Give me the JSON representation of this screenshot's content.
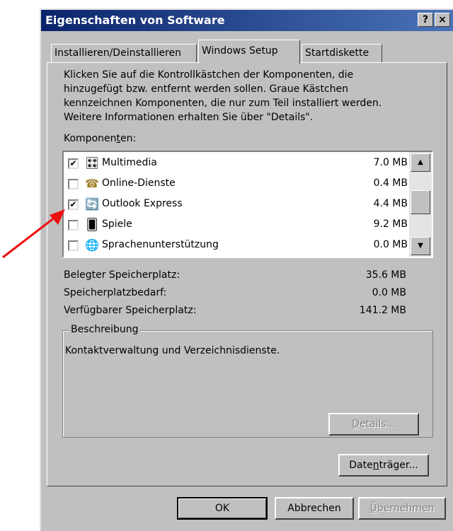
{
  "window": {
    "title": "Eigenschaften von Software",
    "help_button": "?",
    "close_button": "×"
  },
  "tabs": [
    {
      "label": "Installieren/Deinstallieren",
      "active": false
    },
    {
      "label": "Windows Setup",
      "active": true
    },
    {
      "label": "Startdiskette",
      "active": false
    }
  ],
  "instructions": [
    "Klicken Sie auf die Kontrollkästchen der Komponenten, die",
    "hinzugefügt bzw. entfernt werden sollen. Graue Kästchen",
    "kennzeichnen Komponenten, die nur zum Teil installiert werden.",
    "Weitere Informationen erhalten Sie über \"Details\"."
  ],
  "components_label_pre": "Komponen",
  "components_label_accel": "t",
  "components_label_post": "en:",
  "components": [
    {
      "name": "Multimedia",
      "size": "7.0 MB",
      "checked": true,
      "icon": "multimedia-icon",
      "glyph": "🎛"
    },
    {
      "name": "Online-Dienste",
      "size": "0.4 MB",
      "checked": false,
      "icon": "online-services-icon",
      "glyph": "☎"
    },
    {
      "name": "Outlook Express",
      "size": "4.4 MB",
      "checked": true,
      "icon": "outlook-express-icon",
      "glyph": "🔄"
    },
    {
      "name": "Spiele",
      "size": "9.2 MB",
      "checked": false,
      "icon": "games-icon",
      "glyph": "🂠"
    },
    {
      "name": "Sprachenunterstützung",
      "size": "0.0 MB",
      "checked": false,
      "icon": "globe-icon",
      "glyph": "🌐"
    }
  ],
  "space": {
    "used_label": "Belegter Speicherplatz:",
    "used_value": "35.6 MB",
    "required_label": "Speicherplatzbedarf:",
    "required_value": "0.0 MB",
    "available_label": "Verfügbarer Speicherplatz:",
    "available_value": "141.2 MB"
  },
  "description": {
    "group_label": "Beschreibung",
    "text": "Kontaktverwaltung und Verzeichnisdienste.",
    "details_accel": "D",
    "details_rest": "etails..."
  },
  "datentraeger": {
    "pre": "Date",
    "accel": "n",
    "post": "träger..."
  },
  "buttons": {
    "ok": "OK",
    "cancel": "Abbrechen",
    "apply_accel": "Ü",
    "apply_rest": "bernehmen"
  },
  "colors": {
    "title_start": "#0a246a",
    "title_end": "#4a72b8",
    "face": "#c0c0c0",
    "annotation_arrow": "#ee1111"
  }
}
